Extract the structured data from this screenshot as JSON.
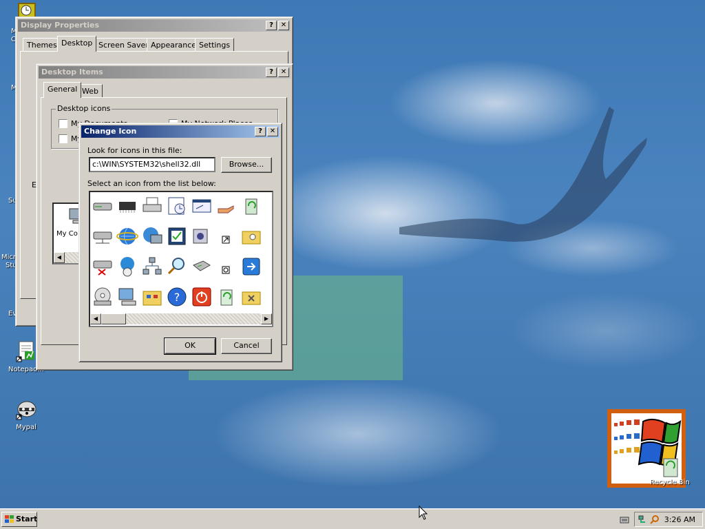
{
  "desktop": {
    "icons": [
      {
        "label": "Notepad..."
      },
      {
        "label": "Mypal"
      }
    ],
    "fragments": [
      "M",
      "C",
      "M",
      "Su",
      "Micro",
      "Stu",
      "Ev"
    ],
    "recycle_label": "Recycle Bin"
  },
  "display_properties": {
    "title": "Display Properties",
    "tabs": [
      "Themes",
      "Desktop",
      "Screen Saver",
      "Appearance",
      "Settings"
    ],
    "selected_tab": "Desktop"
  },
  "desktop_items": {
    "title": "Desktop Items",
    "tabs": [
      "General",
      "Web"
    ],
    "selected_tab": "General",
    "group_title": "Desktop icons",
    "checkboxes": [
      "My Documents",
      "My Network Places",
      "My"
    ],
    "preview_label": "My Co",
    "fragment_e": "E"
  },
  "change_icon": {
    "title": "Change Icon",
    "look_label": "Look for icons in this file:",
    "file_path": "c:\\WIN\\SYSTEM32\\shell32.dll",
    "browse_label": "Browse...",
    "select_label": "Select an icon from the list below:",
    "ok_label": "OK",
    "cancel_label": "Cancel",
    "icons": [
      "hard-drive-icon",
      "memory-chip-icon",
      "printer-icon",
      "scheduled-task-icon",
      "window-shortcut-icon",
      "shared-hand-icon",
      "recycle-bin-full-icon",
      "folder-partial-icon",
      "network-drive-icon",
      "internet-explorer-icon",
      "network-computer-icon",
      "checklist-icon",
      "cd-audio-icon",
      "shortcut-arrow-icon",
      "folder-search-icon",
      "folder-partial-icon",
      "disconnected-drive-icon",
      "globe-mouse-icon",
      "network-icon",
      "magnifier-icon",
      "removable-drive-icon",
      "clock-overlay-icon",
      "log-off-icon",
      "folder-partial-icon",
      "cd-drive-icon",
      "my-computer-icon",
      "control-panel-icon",
      "help-icon",
      "shut-down-icon",
      "recycle-bin-empty-icon",
      "folder-tools-icon",
      "partial-icon"
    ]
  },
  "taskbar": {
    "start_label": "Start",
    "clock": "3:26 AM"
  },
  "titlebar_buttons": {
    "help": "?",
    "close": "✕"
  },
  "colors": {
    "active_title": "#0a246a",
    "inactive_title": "#808080",
    "face": "#d4d0c8"
  }
}
